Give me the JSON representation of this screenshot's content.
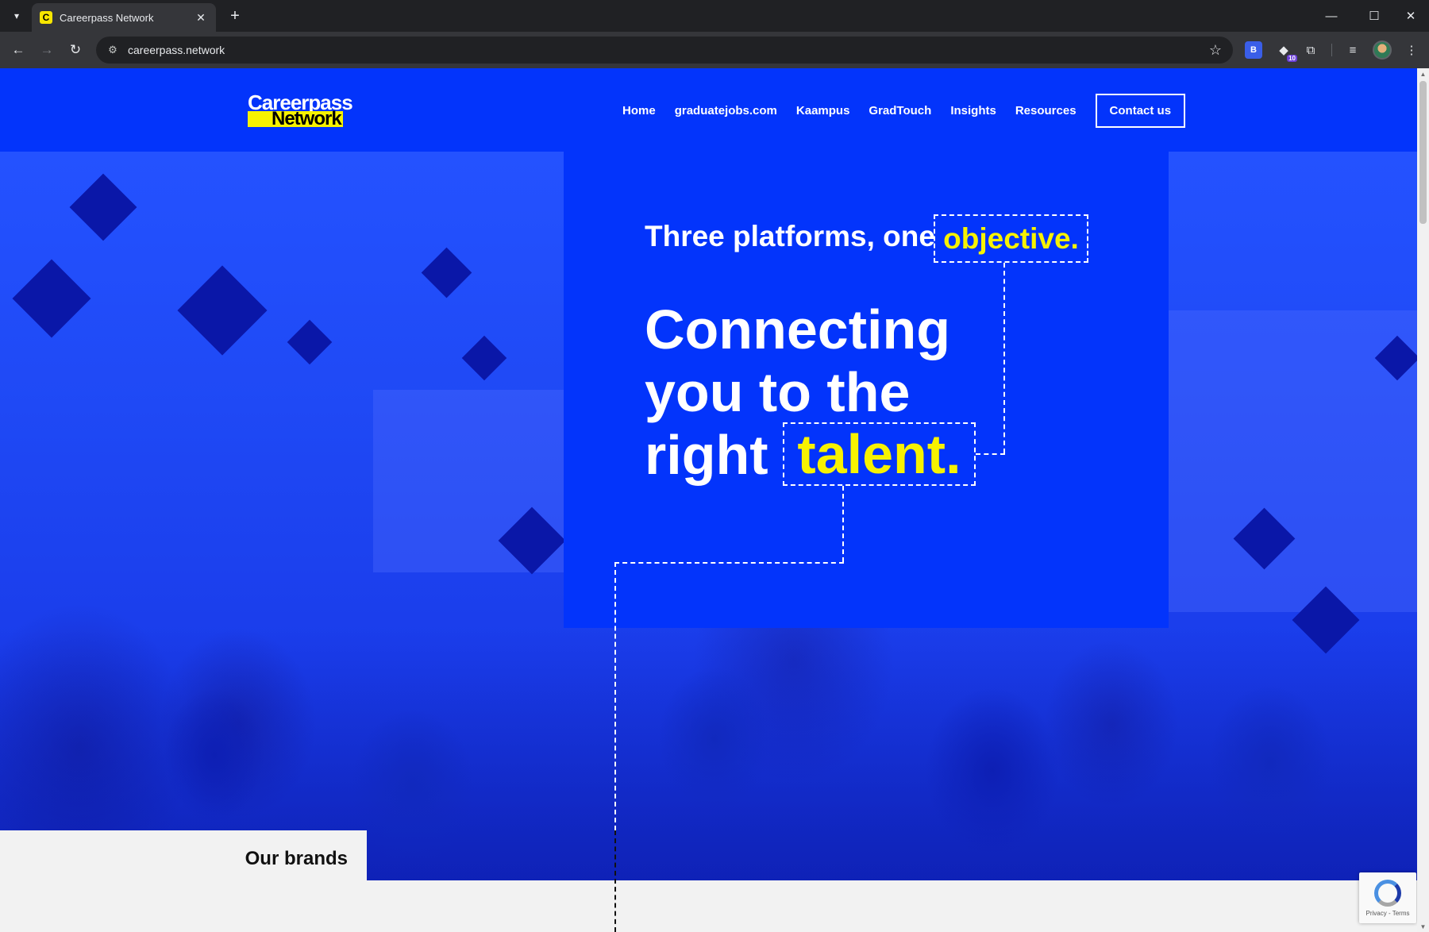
{
  "browser": {
    "tab_title": "Careerpass Network",
    "favicon_letter": "C",
    "url": "careerpass.network",
    "extension_badge": "10"
  },
  "site": {
    "logo": {
      "line1": "Careerpass",
      "line2": "Network"
    },
    "nav": [
      "Home",
      "graduatejobs.com",
      "Kaampus",
      "GradTouch",
      "Insights",
      "Resources"
    ],
    "contact_label": "Contact us"
  },
  "hero": {
    "tagline": "Three platforms, one",
    "tagline_accent": "objective.",
    "headline_line1": "Connecting",
    "headline_line2": "you to the",
    "headline_line3": "right",
    "headline_accent": "talent."
  },
  "brands": {
    "title": "Our brands"
  },
  "recaptcha": {
    "text": "Privacy - Terms"
  },
  "colors": {
    "brand_blue": "#0334fb",
    "accent_yellow": "#f7f200",
    "light_bg": "#f2f2f2"
  },
  "icons": [
    "tab-list-icon",
    "close-icon",
    "plus-icon",
    "minimize-icon",
    "maximize-icon",
    "back-icon",
    "forward-icon",
    "reload-icon",
    "site-info-icon",
    "star-icon",
    "extensions-icon",
    "media-icon",
    "menu-icon"
  ]
}
